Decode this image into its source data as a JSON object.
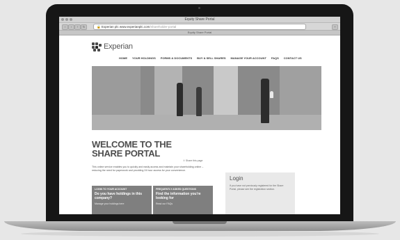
{
  "browser": {
    "window_title": "Equity Share Portal",
    "url_secure": "Experian plc",
    "url_text": "www.experianplc.com",
    "url_dim": "/shareholder-portal",
    "tab_label": "Equity Share Portal"
  },
  "site": {
    "logo_text": "Experian",
    "nav_items": [
      "HOME",
      "YOUR HOLDINGS",
      "FORMS & DOCUMENTS",
      "BUY & SELL SHARES",
      "MANAGE YOUR ACCOUNT",
      "FAQS",
      "CONTACT US"
    ]
  },
  "main": {
    "welcome_line1": "WELCOME TO THE",
    "welcome_line2": "SHARE PORTAL",
    "share_link": "Share this page",
    "intro_text": "This online service enables you to quickly and easily access and maintain your shareholding online – reducing the need for paperwork and providing 24 hour access for your convenience."
  },
  "panels": [
    {
      "head": "LOGIN TO YOUR ACCOUNT",
      "question": "Do you have holdings in this company?",
      "link": "Manage your holdings here"
    },
    {
      "head": "FREQUENTLY ASKED QUESTIONS",
      "question": "Find the information you're looking for",
      "link": "Read our FAQs"
    }
  ],
  "login": {
    "title": "Login",
    "text": "If you have not previously registered for the Share Portal, please see the registration section."
  }
}
